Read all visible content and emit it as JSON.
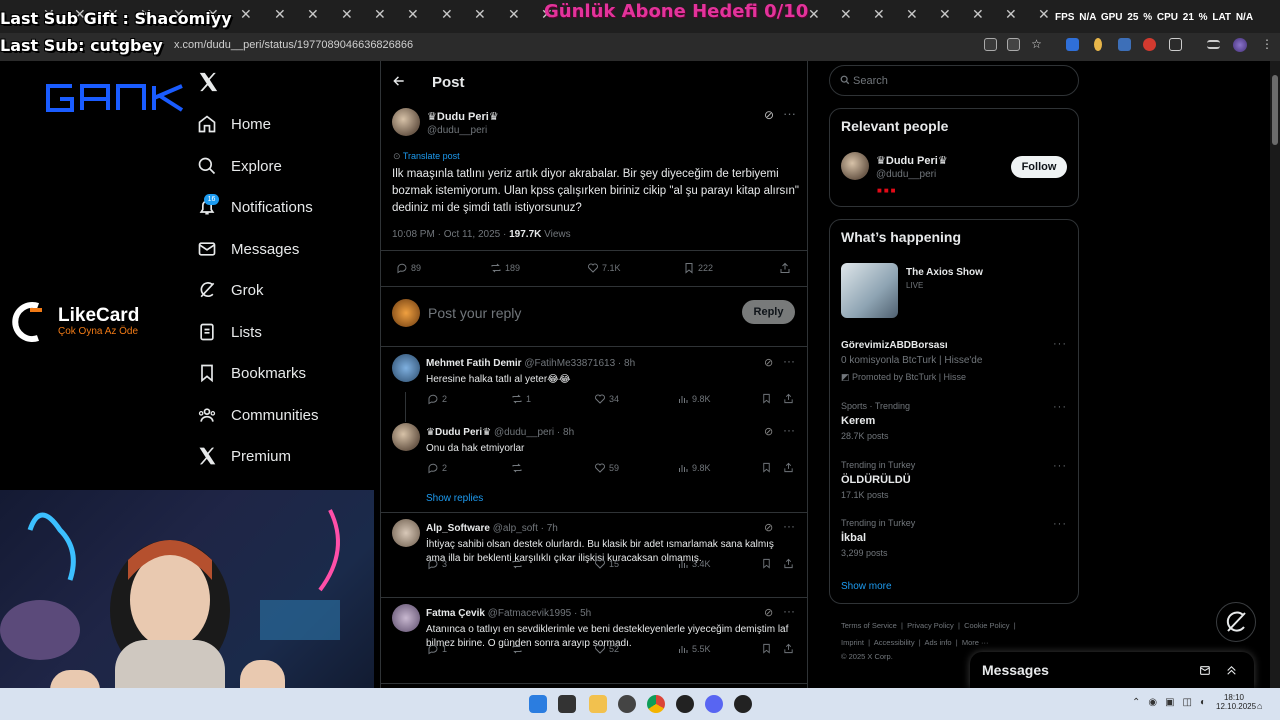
{
  "overlays": {
    "gift": "Last Sub Gift : Shacomiyy",
    "last_sub": "Last Sub: cutgbey",
    "goal": "Günlük Abone Hedefi 0/10",
    "stats": "FPS N/A GPU 25 % CPU 21 % LAT N/A"
  },
  "browser": {
    "url": "x.com/dudu__peri/status/1977089046636826866",
    "tab_close_glyph": "✕"
  },
  "sidebar": {
    "items": [
      {
        "label": "Home",
        "icon": "home-icon"
      },
      {
        "label": "Explore",
        "icon": "search-icon"
      },
      {
        "label": "Notifications",
        "icon": "bell-icon",
        "badge": "16"
      },
      {
        "label": "Messages",
        "icon": "mail-icon"
      },
      {
        "label": "Grok",
        "icon": "grok-icon"
      },
      {
        "label": "Lists",
        "icon": "list-icon"
      },
      {
        "label": "Bookmarks",
        "icon": "bookmark-icon"
      },
      {
        "label": "Communities",
        "icon": "people-icon"
      },
      {
        "label": "Premium",
        "icon": "x-icon"
      }
    ]
  },
  "sponsor": {
    "gank": "GANK",
    "likecard_name": "LikeCard",
    "likecard_tag": "Çok Oyna  Az Öde"
  },
  "post": {
    "header": "Post",
    "author_name": "Dudu Peri",
    "author_handle": "@dudu__peri",
    "translate": "Translate post",
    "text": "Ilk maaşınla tatlını yeriz artık diyor akrabalar. Bir şey diyeceğim de terbiyemi bozmak istemiyorum. Ulan kpss çalışırken biriniz cikip \"al şu parayı kitap alırsın\" dediniz mi de şimdi tatlı istiyorsunuz?",
    "time": "10:08 PM · Oct 11, 2025 · ",
    "views_count": "197.7K",
    "views_label": " Views",
    "replies": "89",
    "reposts": "189",
    "likes": "7.1K",
    "bookmarks": "222"
  },
  "composer": {
    "placeholder": "Post your reply",
    "button": "Reply"
  },
  "replies": [
    {
      "name": "Mehmet Fatih Demir",
      "meta": "@FatihMe33871613 · 8h",
      "text": "Heresine halka tatlı al yeter😂😂",
      "reply": "2",
      "repost": "1",
      "like": "34",
      "views": "9.8K"
    },
    {
      "name": "Dudu Peri",
      "meta": "@dudu__peri · 8h",
      "text": "Onu da hak etmiyorlar",
      "reply": "2",
      "repost": "",
      "like": "59",
      "views": "9.8K"
    },
    {
      "name": "Alp_Software",
      "meta": "@alp_soft · 7h",
      "text": "İhtiyaç sahibi olsan destek olurlardı. Bu klasik bir adet ısmarlamak sana kalmış ama illa bir beklenti karşılıklı çıkar ilişkisi kuracaksan olmamış.",
      "reply": "3",
      "repost": "",
      "like": "15",
      "views": "3.4K"
    },
    {
      "name": "Fatma Çevik",
      "meta": "@Fatmacevik1995 · 5h",
      "text": "Atanınca o tatlıyı en sevdiklerimle ve beni destekleyenlerle yiyeceğim demiştim laf bilmez birine. O günden sonra arayıp sormadı.",
      "reply": "1",
      "repost": "",
      "like": "52",
      "views": "5.5K"
    }
  ],
  "show_replies": "Show replies",
  "right": {
    "search_placeholder": "Search",
    "relevant_title": "Relevant people",
    "person_name": "Dudu Peri",
    "person_handle": "@dudu__peri",
    "follow": "Follow",
    "happening_title": "What’s happening",
    "live_title": "The Axios Show",
    "live_label": "LIVE",
    "promo_name": "GörevimizABDBorsası",
    "promo_desc": "0 komisyonla BtcTurk | Hisse'de",
    "promo_by": "Promoted by BtcTurk | Hisse",
    "trends": [
      {
        "meta": "Sports · Trending",
        "name": "Kerem",
        "posts": "28.7K posts"
      },
      {
        "meta": "Trending in Turkey",
        "name": "ÖLDÜRÜLDÜ",
        "posts": "17.1K posts"
      },
      {
        "meta": "Trending in Turkey",
        "name": "İkbal",
        "posts": "3,299 posts"
      }
    ],
    "show_more": "Show more",
    "footer1": "Terms of Service  |  Privacy Policy  |  Cookie Policy  |",
    "footer2": "Imprint  |  Accessibility  |  Ads info  |  More ···",
    "footer3": "© 2025 X Corp.",
    "messages": "Messages"
  },
  "taskbar": {
    "time": "18:10",
    "date": "12.10.2025"
  }
}
